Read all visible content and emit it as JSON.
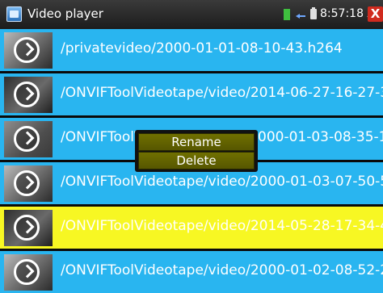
{
  "titlebar": {
    "title": "Video player",
    "time": "8:57:18 AM",
    "close_label": "X",
    "icons": [
      "app-icon",
      "signal-icon",
      "network-icon",
      "battery-icon"
    ]
  },
  "files": [
    {
      "name": "/privatevideo/2000-01-01-08-10-43.h264",
      "selected": false
    },
    {
      "name": "/ONVIFToolVideotape/video/2014-06-27-16-27-3",
      "selected": false
    },
    {
      "name": "/ONVIFTool\\",
      "hidden_suffix": "000-01-03-08-35-1",
      "selected": false
    },
    {
      "name": "/ONVIFToolVideotape/video/2000-01-03-07-50-5",
      "selected": false
    },
    {
      "name": "/ONVIFToolVideotape/video/2014-05-28-17-34-4",
      "selected": true
    },
    {
      "name": "/ONVIFToolVideotape/video/2000-01-02-08-52-2",
      "selected": false
    }
  ],
  "context_menu": {
    "rename": "Rename",
    "delete": "Delete"
  },
  "colors": {
    "row_background": "#29b5f0",
    "selected_row": "#f7f723",
    "menu_item": "#5e5e00",
    "close": "#d02a1e"
  }
}
